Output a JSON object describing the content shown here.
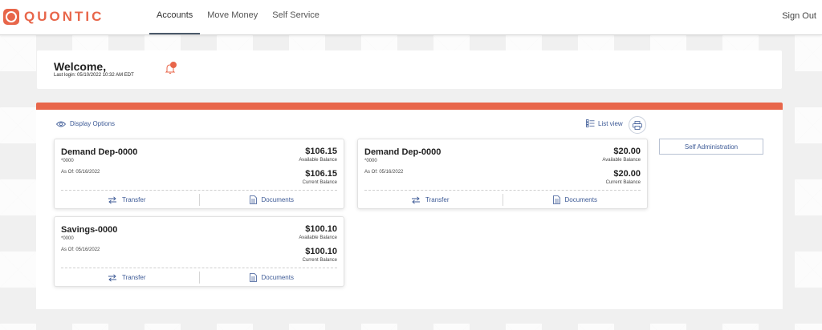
{
  "brand": {
    "name": "QUONTIC",
    "accent": "#e8664a",
    "link_color": "#3d5a96"
  },
  "nav": {
    "items": [
      {
        "label": "Accounts",
        "active": true
      },
      {
        "label": "Move Money",
        "active": false
      },
      {
        "label": "Self Service",
        "active": false
      }
    ],
    "signout": "Sign Out"
  },
  "welcome": {
    "title": "Welcome,",
    "last_login": "Last login: 05/10/2022 10:32 AM EDT",
    "bell_icon": "bell-icon"
  },
  "toolbar": {
    "display_options": "Display Options",
    "list_view": "List view",
    "print_icon": "print-icon"
  },
  "accounts": [
    {
      "name": "Demand Dep-0000",
      "number": "*0000",
      "as_of": "As Of: 05/16/2022",
      "available_amount": "$106.15",
      "available_label": "Available Balance",
      "current_amount": "$106.15",
      "current_label": "Current Balance",
      "actions": [
        "Transfer",
        "Documents"
      ]
    },
    {
      "name": "Demand Dep-0000",
      "number": "*0000",
      "as_of": "As Of: 05/16/2022",
      "available_amount": "$20.00",
      "available_label": "Available Balance",
      "current_amount": "$20.00",
      "current_label": "Current Balance",
      "actions": [
        "Transfer",
        "Documents"
      ]
    },
    {
      "name": "Savings-0000",
      "number": "*0000",
      "as_of": "As Of: 05/16/2022",
      "available_amount": "$100.10",
      "available_label": "Available Balance",
      "current_amount": "$100.10",
      "current_label": "Current Balance",
      "actions": [
        "Transfer",
        "Documents"
      ]
    }
  ],
  "sidebar": {
    "self_admin": "Self Administration"
  }
}
